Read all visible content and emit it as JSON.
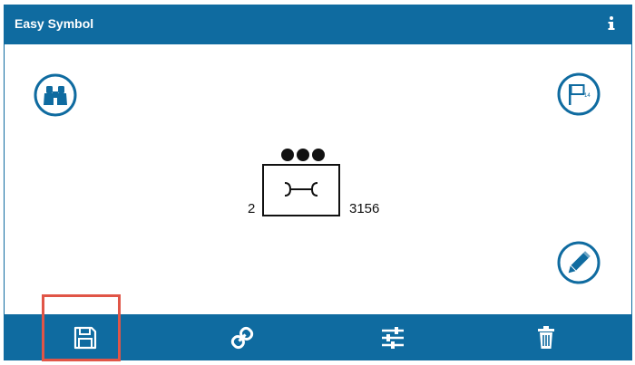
{
  "header": {
    "title": "Easy Symbol",
    "info_icon": "info-icon"
  },
  "actions": {
    "search_icon": "binoculars-icon",
    "flag_icon": "flag-icon",
    "flag_badge": "14",
    "edit_icon": "pencil-icon"
  },
  "symbol": {
    "left_label": "2",
    "right_label": "3156",
    "dot_count": 3,
    "glyph": "wrench-icon"
  },
  "toolbar": {
    "items": [
      {
        "icon": "save-icon",
        "selected": true
      },
      {
        "icon": "link-icon",
        "selected": false
      },
      {
        "icon": "sliders-icon",
        "selected": false
      },
      {
        "icon": "trash-icon",
        "selected": false
      }
    ]
  },
  "colors": {
    "primary": "#0f6ba0",
    "highlight": "#e05547",
    "symbol": "#111111"
  }
}
